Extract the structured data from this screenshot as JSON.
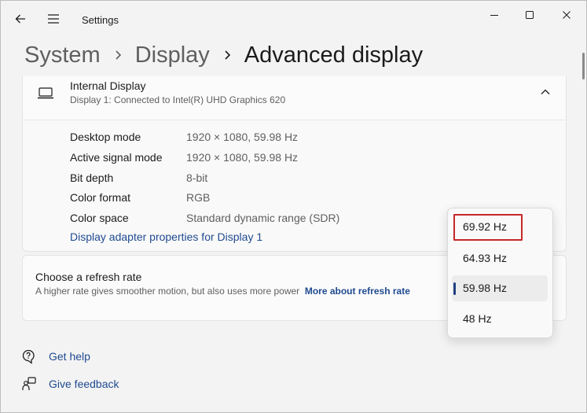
{
  "app": {
    "title": "Settings"
  },
  "breadcrumb": {
    "items": [
      "System",
      "Display",
      "Advanced display"
    ]
  },
  "display_card": {
    "name": "Internal Display",
    "subtitle": "Display 1: Connected to Intel(R) UHD Graphics 620",
    "rows": [
      {
        "label": "Desktop mode",
        "value": "1920 × 1080, 59.98 Hz"
      },
      {
        "label": "Active signal mode",
        "value": "1920 × 1080, 59.98 Hz"
      },
      {
        "label": "Bit depth",
        "value": "8-bit"
      },
      {
        "label": "Color format",
        "value": "RGB"
      },
      {
        "label": "Color space",
        "value": "Standard dynamic range (SDR)"
      }
    ],
    "adapter_link": "Display adapter properties for Display 1"
  },
  "refresh_card": {
    "title": "Choose a refresh rate",
    "description": "A higher rate gives smoother motion, but also uses more power",
    "link": "More about refresh rate"
  },
  "refresh_dropdown": {
    "options": [
      "69.92 Hz",
      "64.93 Hz",
      "59.98 Hz",
      "48 Hz"
    ],
    "selected": "59.98 Hz",
    "highlighted": "69.92 Hz"
  },
  "footer": {
    "help": "Get help",
    "feedback": "Give feedback"
  },
  "colors": {
    "accent": "#1f4a90",
    "highlight_border": "#c62828",
    "background": "#f3f3f3"
  },
  "icons": [
    "back-arrow-icon",
    "hamburger-menu-icon",
    "minimize-icon",
    "maximize-icon",
    "close-icon",
    "chevron-right-icon",
    "monitor-icon",
    "chevron-up-icon",
    "help-icon",
    "feedback-icon"
  ]
}
